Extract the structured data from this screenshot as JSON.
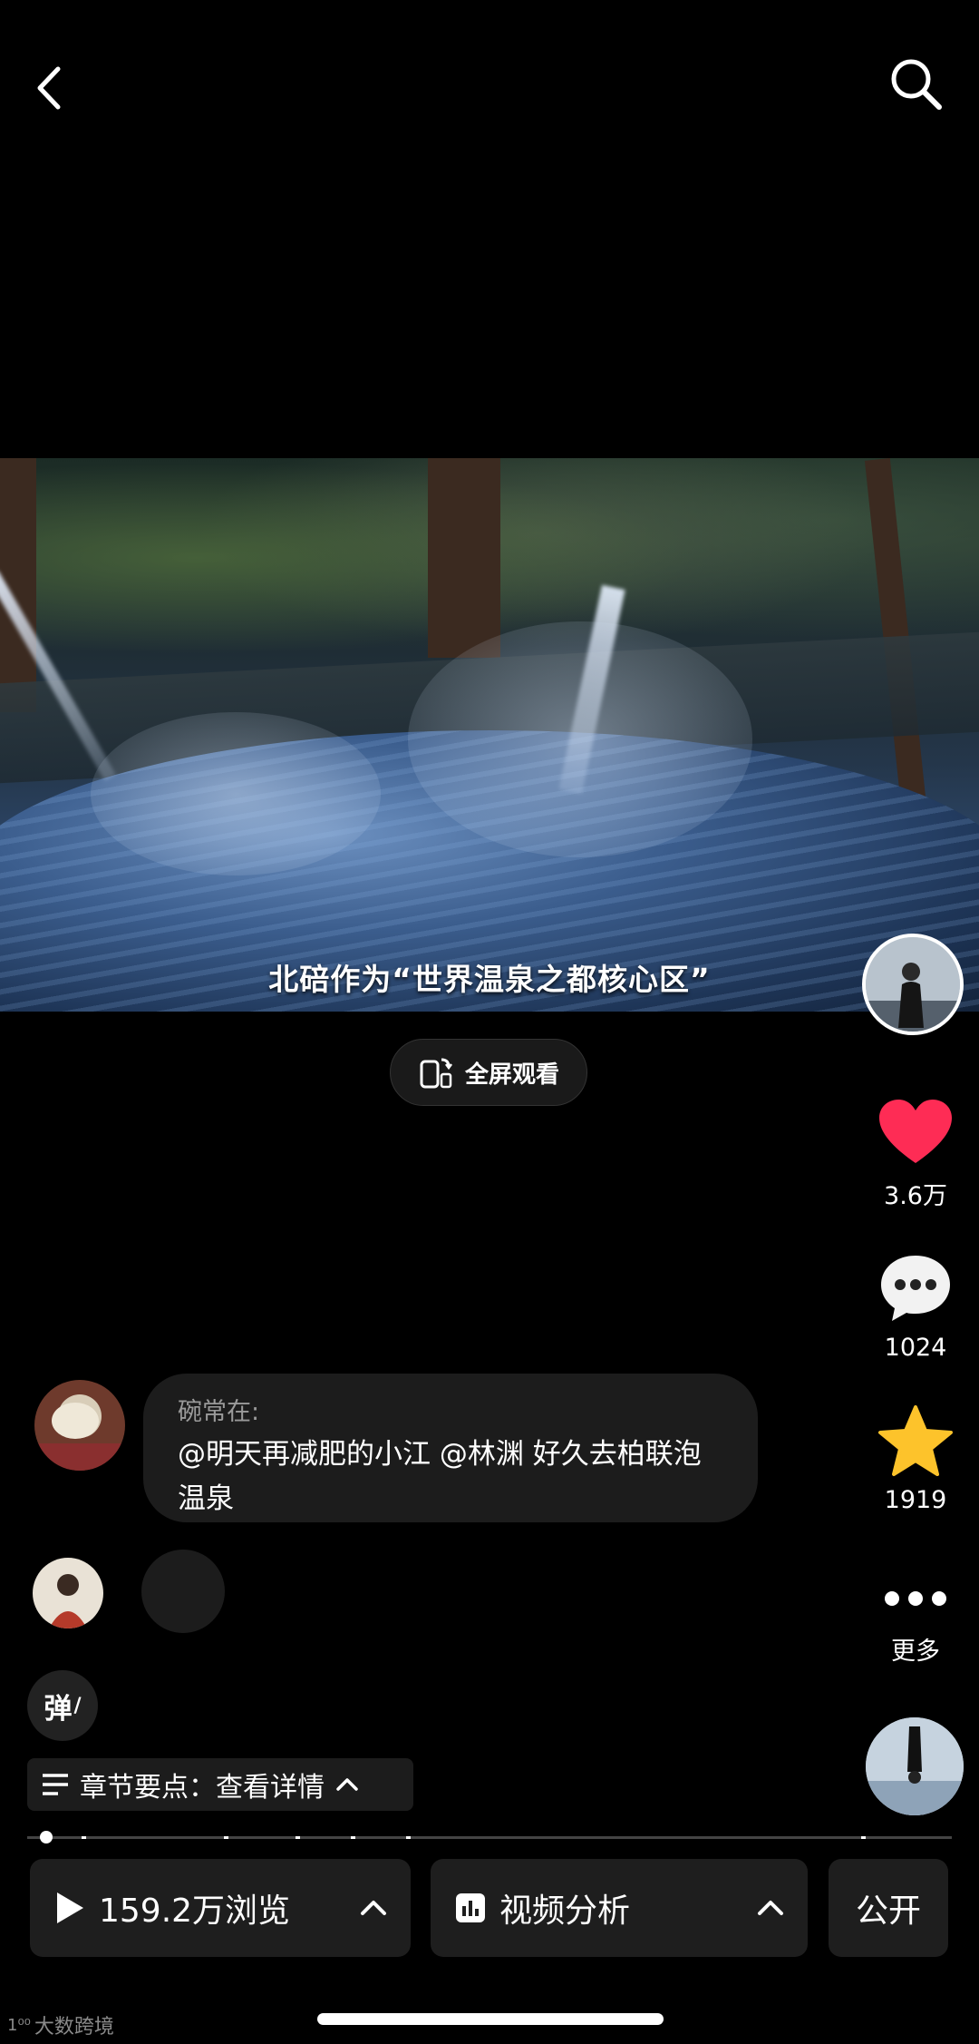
{
  "video": {
    "subtitle": "北碚作为“世界温泉之都核心区”"
  },
  "fullscreen_label": "全屏观看",
  "rail": {
    "like_count": "3.6万",
    "comment_count": "1024",
    "favorite_count": "1919",
    "more_label": "更多",
    "like_color": "#fe2c55",
    "favorite_color": "#fdc32b"
  },
  "comment": {
    "user": "碗常在:",
    "text": "@明天再减肥的小江 @林渊 好久去柏联泡温泉"
  },
  "danmaku_label": "弹",
  "chapter": {
    "label": "章节要点：查看详情"
  },
  "bottom": {
    "views_label": "159.2万浏览",
    "analysis_label": "视频分析",
    "visibility_label": "公开"
  },
  "watermark": "大数跨境",
  "icons": [
    "back-icon",
    "search-icon",
    "phone-rotate-icon",
    "heart-icon",
    "comment-icon",
    "star-icon",
    "more-dots-icon",
    "play-icon",
    "chevron-up-icon",
    "chart-icon",
    "list-icon"
  ]
}
